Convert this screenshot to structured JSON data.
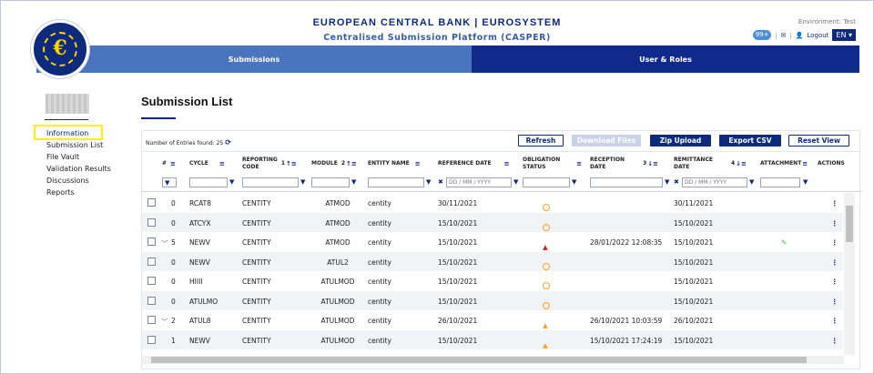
{
  "header": {
    "title": "EUROPEAN CENTRAL BANK | EUROSYSTEM",
    "subtitle": "Centralised Submission Platform (CASPER)",
    "environment": "Environment: Test",
    "logout": "Logout",
    "language": "EN"
  },
  "nav": {
    "submissions": "Submissions",
    "user_roles": "User & Roles"
  },
  "sidebar": {
    "items": [
      {
        "label": "Information"
      },
      {
        "label": "Submission List"
      },
      {
        "label": "File Vault"
      },
      {
        "label": "Validation Results"
      },
      {
        "label": "Discussions"
      },
      {
        "label": "Reports"
      }
    ]
  },
  "page": {
    "title": "Submission List",
    "count_label": "Number of Entries found:",
    "count": "25"
  },
  "toolbar": {
    "refresh": "Refresh",
    "download": "Download Files",
    "zip": "Zip Upload",
    "export": "Export CSV",
    "reset": "Reset View"
  },
  "columns": {
    "num": "#",
    "cycle": "CYCLE",
    "reporting_code": "REPORTING CODE",
    "reporting_code_sort": "1",
    "module": "MODULE",
    "module_sort": "2",
    "entity": "ENTITY NAME",
    "reference_date": "REFERENCE DATE",
    "obligation": "OBLIGATION STATUS",
    "reception": "RECEPTION DATE",
    "reception_sort": "3",
    "remittance": "REMITTANCE DATE",
    "remittance_sort": "4",
    "attachment": "ATTACHMENT",
    "actions": "ACTIONS",
    "date_placeholder": "DD / MM / YYYY"
  },
  "rows": [
    {
      "expand": "",
      "num": "0",
      "cycle": "RCAT8",
      "code": "CENTITY",
      "module": "ATMOD",
      "entity": "centity",
      "ref": "30/11/2021",
      "status": "clock",
      "reception": "",
      "remittance": "30/11/2021",
      "attach": ""
    },
    {
      "expand": "",
      "num": "0",
      "cycle": "ATCYX",
      "code": "CENTITY",
      "module": "ATMOD",
      "entity": "centity",
      "ref": "15/10/2021",
      "status": "clock",
      "reception": "",
      "remittance": "15/10/2021",
      "attach": ""
    },
    {
      "expand": "﹀",
      "num": "5",
      "cycle": "NEWV",
      "code": "CENTITY",
      "module": "ATMOD",
      "entity": "centity",
      "ref": "15/10/2021",
      "status": "error",
      "reception": "28/01/2022 12:08:35",
      "remittance": "15/10/2021",
      "attach": "clip"
    },
    {
      "expand": "",
      "num": "0",
      "cycle": "NEWV",
      "code": "CENTITY",
      "module": "ATUL2",
      "entity": "centity",
      "ref": "15/10/2021",
      "status": "clock",
      "reception": "",
      "remittance": "15/10/2021",
      "attach": ""
    },
    {
      "expand": "",
      "num": "0",
      "cycle": "HIIII",
      "code": "CENTITY",
      "module": "ATULMOD",
      "entity": "centity",
      "ref": "15/10/2021",
      "status": "clock",
      "reception": "",
      "remittance": "15/10/2021",
      "attach": ""
    },
    {
      "expand": "",
      "num": "0",
      "cycle": "ATULMO",
      "code": "CENTITY",
      "module": "ATULMOD",
      "entity": "centity",
      "ref": "15/10/2021",
      "status": "clock",
      "reception": "",
      "remittance": "15/10/2021",
      "attach": ""
    },
    {
      "expand": "﹀",
      "num": "2",
      "cycle": "ATUL8",
      "code": "CENTITY",
      "module": "ATULMOD",
      "entity": "centity",
      "ref": "26/10/2021",
      "status": "warning",
      "reception": "26/10/2021 10:03:59",
      "remittance": "26/10/2021",
      "attach": ""
    },
    {
      "expand": "",
      "num": "1",
      "cycle": "NEWV",
      "code": "CENTITY",
      "module": "ATULMOD",
      "entity": "centity",
      "ref": "15/10/2021",
      "status": "warning",
      "reception": "15/10/2021 17:24:19",
      "remittance": "15/10/2021",
      "attach": ""
    }
  ]
}
